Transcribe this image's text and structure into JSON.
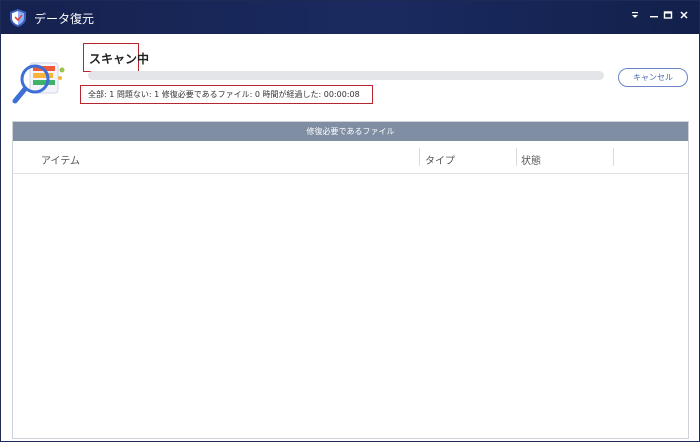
{
  "window": {
    "title": "データ復元",
    "controls": [
      "dropdown-icon",
      "minimize-icon",
      "maximize-icon",
      "close-icon"
    ]
  },
  "scan": {
    "title": "スキャン中",
    "progress_fraction": 0.0,
    "status_line": "全部: 1  問題ない: 1  修復必要であるファイル: 0  時間が経過した: 00:00:08",
    "cancel_label": "キャンセル"
  },
  "panel": {
    "header": "修復必要であるファイル",
    "columns": [
      "アイテム",
      "タイプ",
      "状態"
    ],
    "rows": []
  },
  "colors": {
    "titlebar": "#16224f",
    "highlight_border": "#b5272d",
    "accent": "#4767ad",
    "panel_header": "#7f8ea3"
  }
}
